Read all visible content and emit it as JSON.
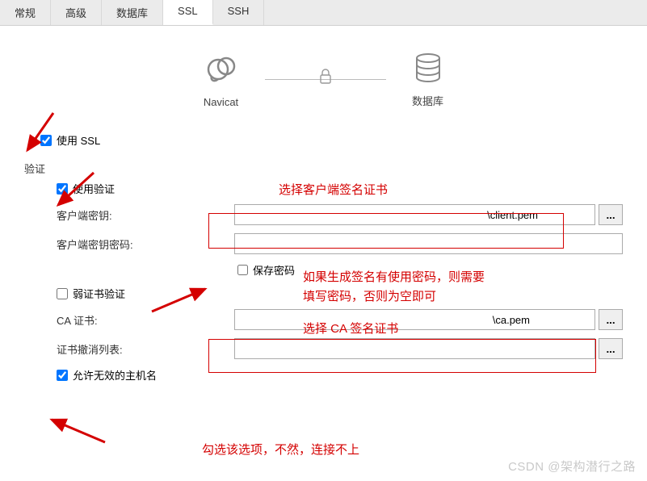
{
  "tabs": {
    "general": "常规",
    "advanced": "高级",
    "database_tab": "数据库",
    "ssl": "SSL",
    "ssh": "SSH"
  },
  "diagram": {
    "client_label": "Navicat",
    "server_label": "数据库"
  },
  "ssl": {
    "use_ssl": "使用 SSL",
    "verify_section": "验证",
    "use_verify": "使用验证",
    "client_key_label": "客户端密钥:",
    "client_key_value": "\\client.pem",
    "client_key_pw_label": "客户端密钥密码:",
    "client_key_pw_value": "",
    "save_pw": "保存密码",
    "weak_verify": "弱证书验证",
    "ca_cert_label": "CA 证书:",
    "ca_cert_value": "\\ca.pem",
    "crl_label": "证书撤消列表:",
    "crl_value": "",
    "allow_invalid_host": "允许无效的主机名"
  },
  "annotations": {
    "a1": "选择客户端签名证书",
    "a2": "如果生成签名有使用密码，则需要",
    "a2b": "填写密码，否则为空即可",
    "a3": "选择 CA 签名证书",
    "a4": "勾选该选项，不然，连接不上"
  },
  "watermark": "CSDN @架构潜行之路",
  "browse_label": "..."
}
